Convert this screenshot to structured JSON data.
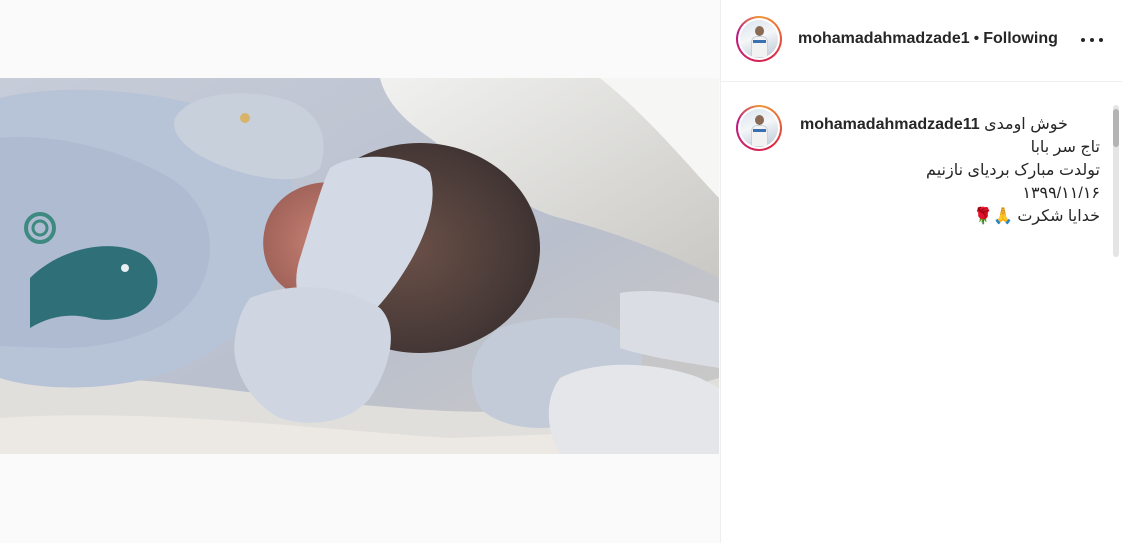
{
  "post": {
    "username": "mohamadahmadzade1",
    "separator": "•",
    "follow_status": "Following",
    "photo_alt": "newborn baby sleeping in light blue clothes"
  },
  "caption": {
    "username": "mohamadahmadzade11",
    "lines": [
      "خوش اومدی",
      "تاج سر بابا",
      "تولدت مبارک بردیای نازنیم",
      "۱۳۹۹/۱۱/۱۶",
      "خدایا شکرت 🙏🌹"
    ]
  },
  "icons": {
    "more": "more-options-icon",
    "avatar": "profile-avatar"
  },
  "colors": {
    "text": "#262626",
    "border": "#efefef",
    "story_ring": "#dc2743"
  }
}
